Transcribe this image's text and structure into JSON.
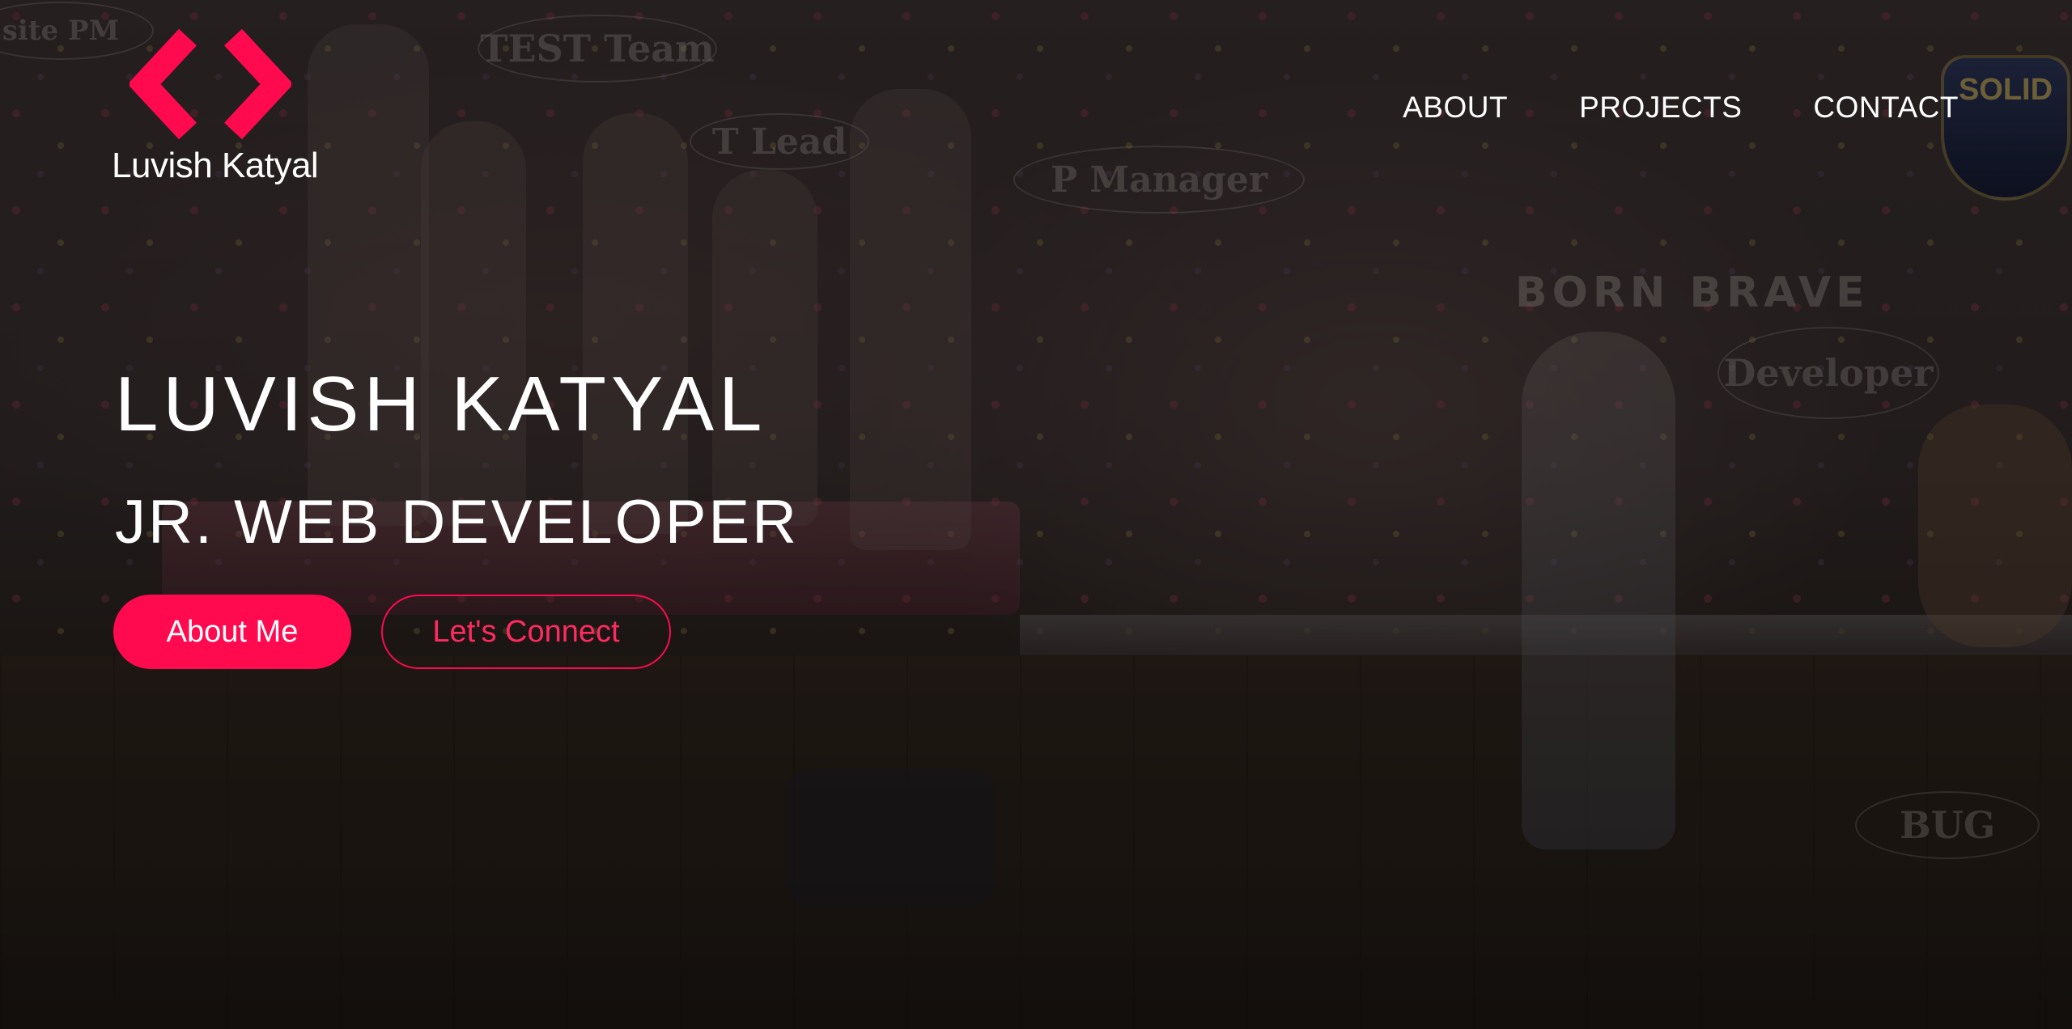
{
  "brand": {
    "logo_text": "Luvish Katyal",
    "accent_color": "#ff0a4f"
  },
  "nav": {
    "items": [
      "ABOUT",
      "PROJECTS",
      "CONTACT"
    ]
  },
  "hero": {
    "name": "LUVISH KATYAL",
    "role": "JR. WEB DEVELOPER",
    "primary_button": "About Me",
    "secondary_button": "Let's Connect"
  },
  "background_image": {
    "bubbles": [
      "site PM",
      "TEST Team",
      "T Lead",
      "P Manager",
      "Developer",
      "BUG"
    ],
    "wall_text": "BORN BRAVE",
    "badge_text": "SOLID"
  }
}
